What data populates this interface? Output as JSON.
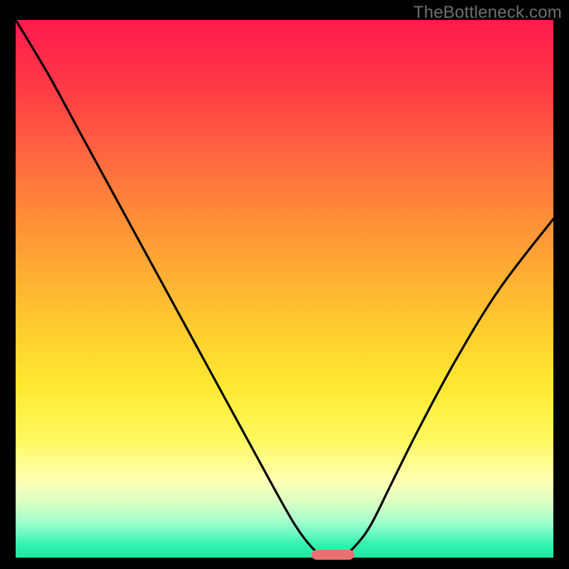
{
  "watermark": "TheBottleneck.com",
  "colors": {
    "background": "#000000",
    "watermark_text": "#6f6f6f",
    "marker": "#e97070",
    "curve": "#000000"
  },
  "chart_data": {
    "type": "line",
    "title": "",
    "xlabel": "",
    "ylabel": "",
    "xlim": [
      0,
      100
    ],
    "ylim": [
      0,
      100
    ],
    "grid": false,
    "series": [
      {
        "name": "bottleneck-curve",
        "x": [
          0,
          6,
          12,
          18,
          24,
          30,
          36,
          42,
          48,
          52,
          55,
          57,
          59,
          61,
          63,
          66,
          70,
          75,
          82,
          90,
          100
        ],
        "values": [
          100,
          90,
          79,
          68,
          57,
          46,
          35,
          24,
          13,
          6,
          2,
          0.5,
          0.5,
          0.5,
          2,
          6,
          14,
          24,
          37,
          50,
          63
        ]
      }
    ],
    "marker": {
      "x_start": 55,
      "x_end": 63,
      "y": 0.5
    },
    "gradient_stops": [
      {
        "pos": 0,
        "color": "#ff1a4d"
      },
      {
        "pos": 0.46,
        "color": "#ffaa33"
      },
      {
        "pos": 0.78,
        "color": "#fff95f"
      },
      {
        "pos": 1.0,
        "color": "#1de9a3"
      }
    ]
  }
}
